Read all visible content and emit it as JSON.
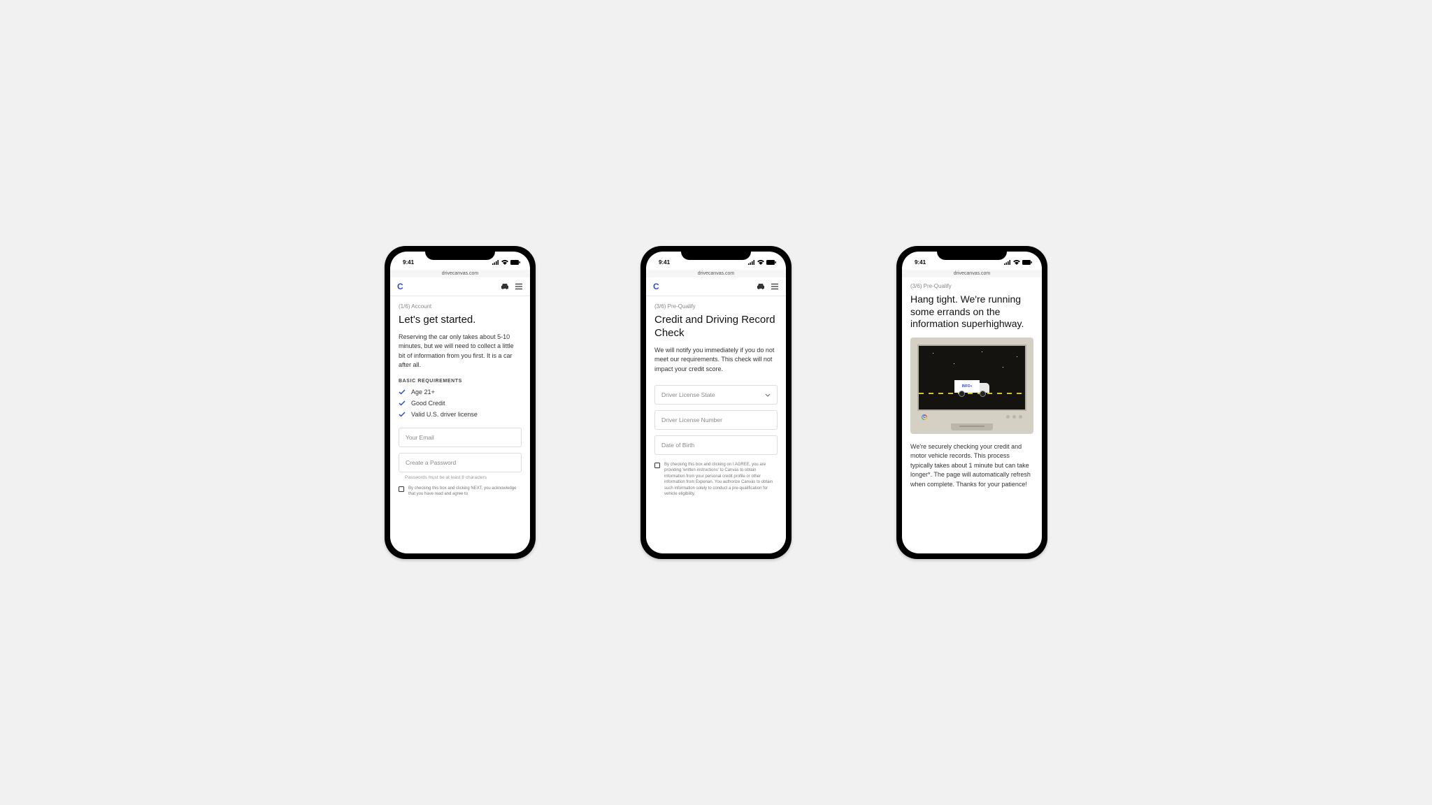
{
  "status": {
    "time": "9:41",
    "url": "drivecanvas.com"
  },
  "logo": "C",
  "screen1": {
    "step": "(1/6) Account",
    "title": "Let's get started.",
    "desc": "Reserving the car only takes about 5-10 minutes, but we will need to collect a little bit of information from you first. It is a car after all.",
    "section": "BASIC REQUIREMENTS",
    "req1": "Age 21+",
    "req2": "Good Credit",
    "req3": "Valid U.S. driver license",
    "email_ph": "Your Email",
    "pass_ph": "Create a Password",
    "pass_hint": "Passwords must be at least 8 characters",
    "consent": "By checking this box and clicking NEXT, you acknowledge that you have read and agree to"
  },
  "screen2": {
    "step": "(3/6) Pre-Qualify",
    "title": "Credit and Driving Record Check",
    "desc": "We will notify you immediately if you do not meet our requirements. This check will not impact your credit score.",
    "state_ph": "Driver License State",
    "license_ph": "Driver License Number",
    "dob_ph": "Date of Birth",
    "consent": "By checking this box and clicking on I AGREE, you are providing 'written instructions' to Canvas to obtain information from your personal credit profile or other information from Experian. You authorize Canvas to obtain such information solely to conduct a pre-qualification for vehicle eligibility."
  },
  "screen3": {
    "step": "(3/6) Pre-Qualify",
    "title": "Hang tight. We're running some errands on the information superhighway.",
    "truck": "INFO»",
    "desc": "We're securely checking your credit and motor vehicle records. This process typically takes about 1 minute but can take longer*. The page will automatically refresh when complete. Thanks for your patience!"
  }
}
